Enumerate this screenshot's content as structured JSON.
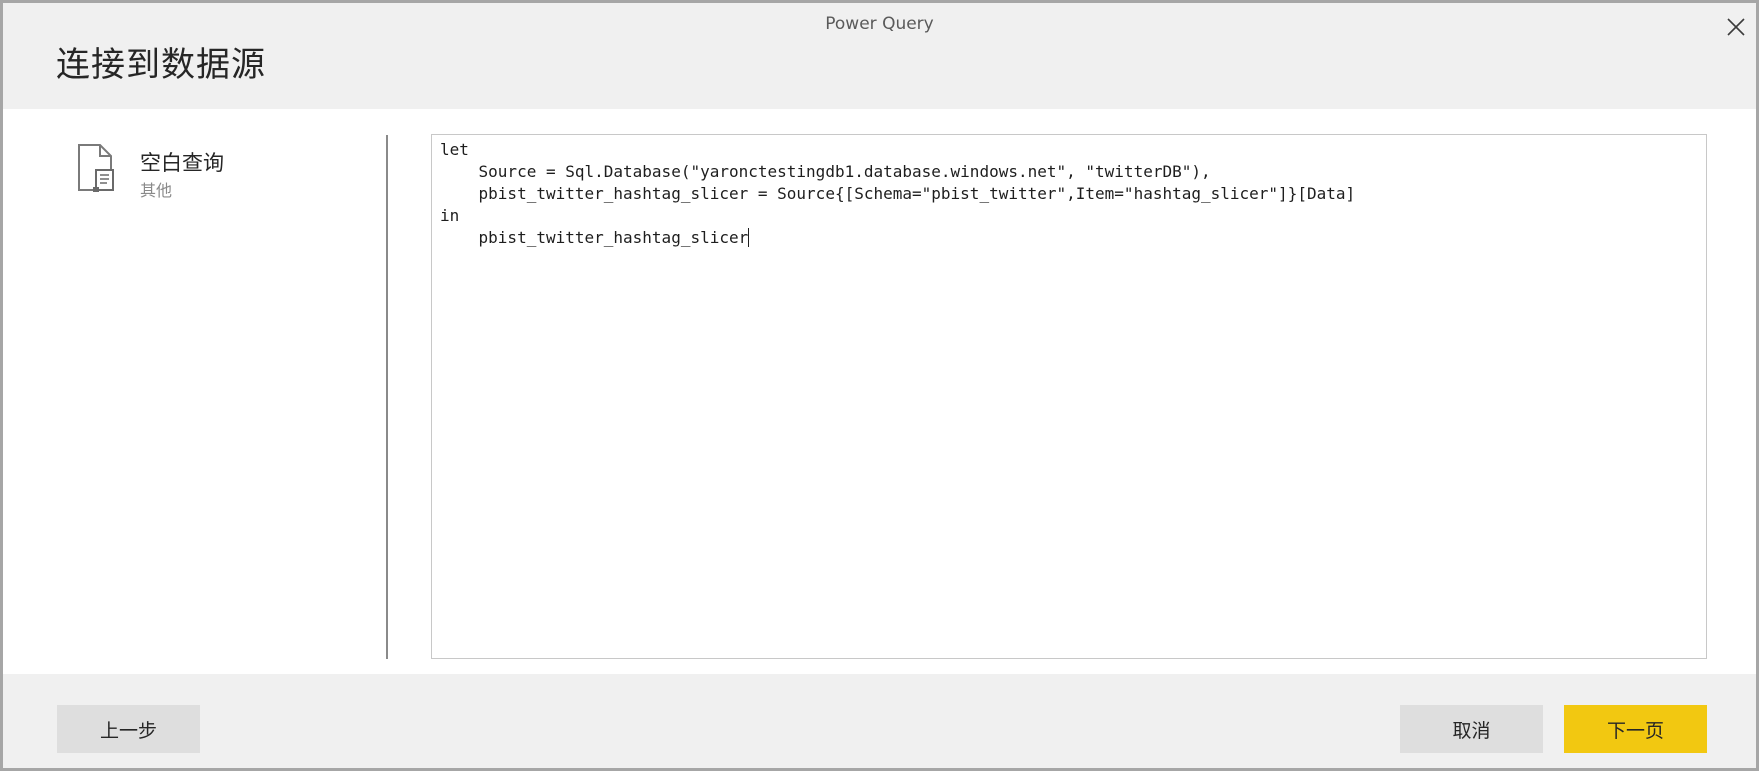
{
  "window": {
    "app_title": "Power Query",
    "page_title": "连接到数据源"
  },
  "sidebar": {
    "source": {
      "name": "空白查询",
      "category": "其他",
      "icon": "blank-document-icon"
    }
  },
  "editor": {
    "lines": [
      "let",
      "    Source = Sql.Database(\"yaronctestingdb1.database.windows.net\", \"twitterDB\"),",
      "    pbist_twitter_hashtag_slicer = Source{[Schema=\"pbist_twitter\",Item=\"hashtag_slicer\"]}[Data]",
      "in",
      "    pbist_twitter_hashtag_slicer"
    ]
  },
  "footer": {
    "back_label": "上一步",
    "cancel_label": "取消",
    "next_label": "下一页"
  },
  "colors": {
    "accent": "#f2c811",
    "header_bg": "#f0f0f0",
    "button_bg": "#dedede"
  }
}
